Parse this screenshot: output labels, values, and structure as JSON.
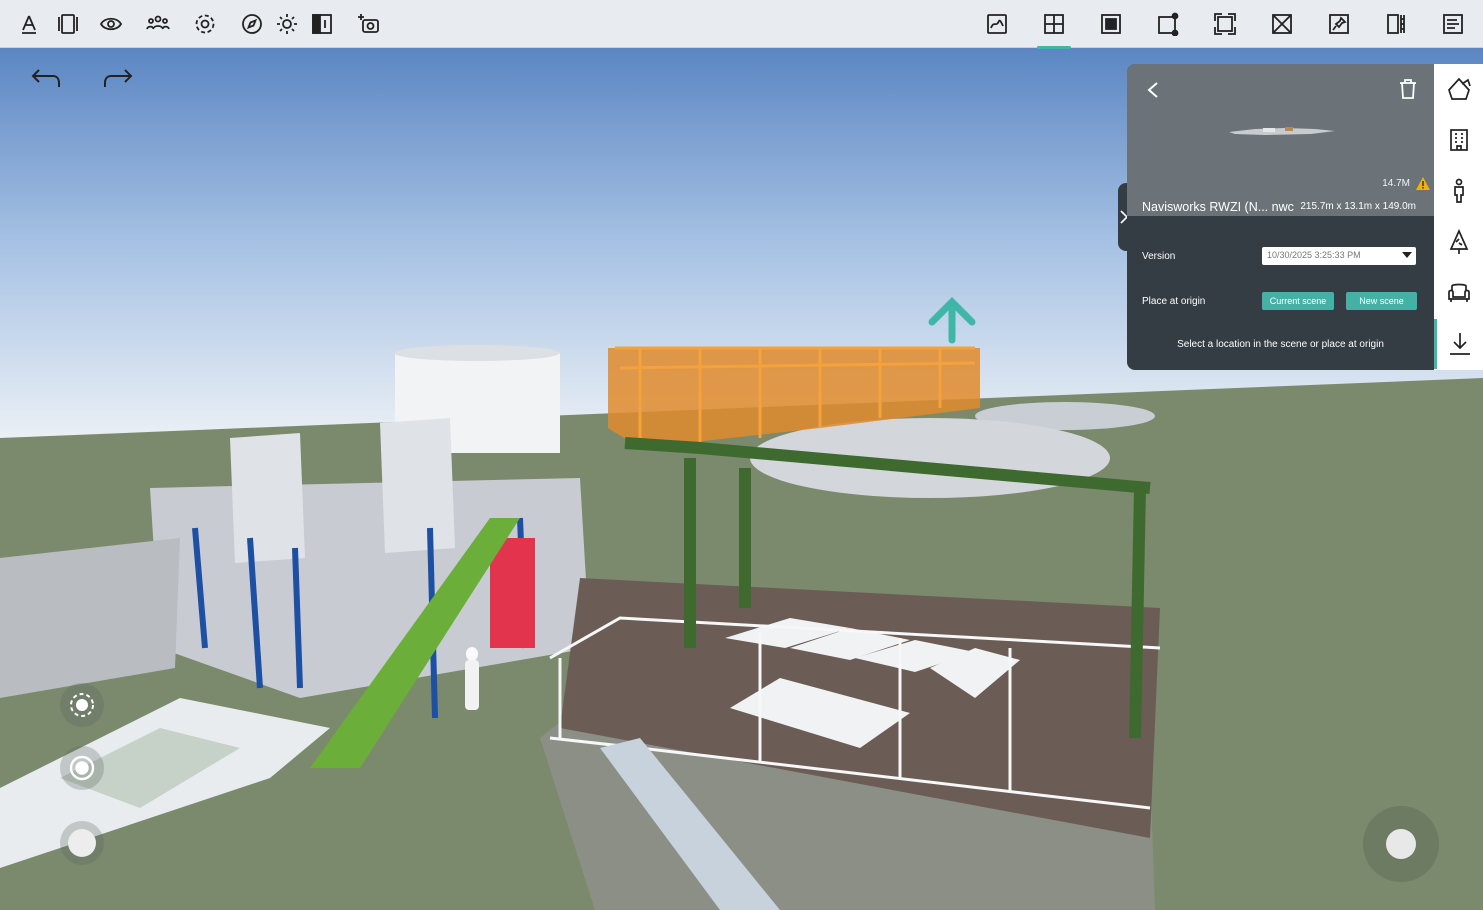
{
  "toolbar": {
    "left_icons": [
      "compass-pen-icon",
      "panels-icon",
      "eye-icon",
      "people-icon",
      "settings-icon",
      "navigation-icon",
      "sun-icon",
      "split-view-icon",
      "camera-icon"
    ],
    "right_icons": [
      "sketch-icon",
      "add-model-icon",
      "solid-view-icon",
      "crop-icon",
      "resize-icon",
      "section-icon",
      "pin-icon",
      "measure-icon",
      "report-icon"
    ],
    "active_right_index": 1
  },
  "history": {
    "undo_icon": "undo-icon",
    "redo_icon": "redo-icon"
  },
  "panel": {
    "size": "14.7M",
    "model_name": "Navisworks RWZI (N... nwc",
    "model_dims": "215.7m x 13.1m x 149.0m",
    "version_label": "Version",
    "version_value": "10/30/2025 3:25:33 PM",
    "place_label": "Place at origin",
    "current_scene": "Current scene",
    "new_scene": "New scene",
    "hint": "Select a location in the scene or place at origin"
  },
  "side_icons": [
    "shape-icon",
    "building-icon",
    "person-icon",
    "tree-icon",
    "armchair-icon",
    "download-icon"
  ],
  "colors": {
    "accent": "#3fb6a8",
    "panel_bg": "#343d44",
    "toolbar_bg": "#e8ebf0",
    "ground": "#7b8a6c",
    "warning": "#f0b400"
  }
}
